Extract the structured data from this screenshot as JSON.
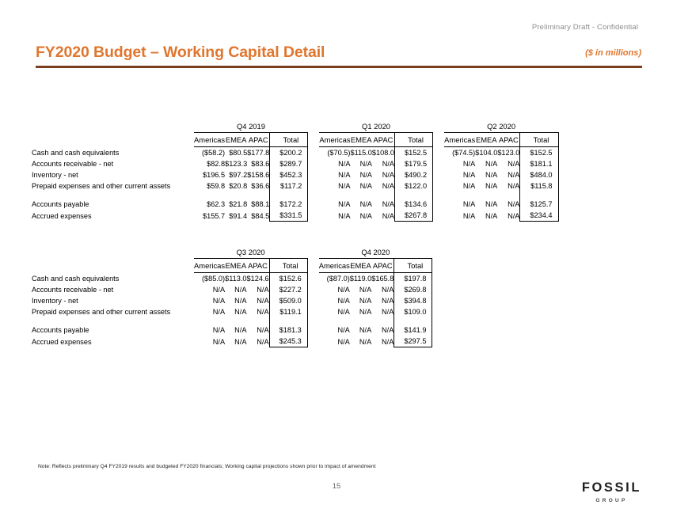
{
  "header": {
    "confidential": "Preliminary Draft - Confidential",
    "title": "FY2020 Budget – Working Capital Detail",
    "units": "($ in millions)",
    "accent_color": "#e0762e",
    "rule_color": "#7b3f1d"
  },
  "row_labels": [
    "Cash and cash equivalents",
    "Accounts receivable - net",
    "Inventory  - net",
    "Prepaid expenses and other current assets",
    "Accounts payable",
    "Accrued expenses"
  ],
  "column_headers": [
    "Americas",
    "EMEA",
    "APAC",
    "Total"
  ],
  "table_one": {
    "quarters": [
      "Q4 2019",
      "Q1 2020",
      "Q2 2020"
    ],
    "groups": [
      {
        "quarter": "Q4 2019",
        "rows": [
          [
            "($58.2)",
            "$80.5",
            "$177.8",
            "$200.2"
          ],
          [
            "$82.8",
            "$123.3",
            "$83.6",
            "$289.7"
          ],
          [
            "$196.5",
            "$97.2",
            "$158.6",
            "$452.3"
          ],
          [
            "$59.8",
            "$20.8",
            "$36.6",
            "$117.2"
          ],
          [
            "$62.3",
            "$21.8",
            "$88.1",
            "$172.2"
          ],
          [
            "$155.7",
            "$91.4",
            "$84.5",
            "$331.5"
          ]
        ]
      },
      {
        "quarter": "Q1 2020",
        "rows": [
          [
            "($70.5)",
            "$115.0",
            "$108.0",
            "$152.5"
          ],
          [
            "N/A",
            "N/A",
            "N/A",
            "$179.5"
          ],
          [
            "N/A",
            "N/A",
            "N/A",
            "$490.2"
          ],
          [
            "N/A",
            "N/A",
            "N/A",
            "$122.0"
          ],
          [
            "N/A",
            "N/A",
            "N/A",
            "$134.6"
          ],
          [
            "N/A",
            "N/A",
            "N/A",
            "$267.8"
          ]
        ]
      },
      {
        "quarter": "Q2 2020",
        "rows": [
          [
            "($74.5)",
            "$104.0",
            "$123.0",
            "$152.5"
          ],
          [
            "N/A",
            "N/A",
            "N/A",
            "$181.1"
          ],
          [
            "N/A",
            "N/A",
            "N/A",
            "$484.0"
          ],
          [
            "N/A",
            "N/A",
            "N/A",
            "$115.8"
          ],
          [
            "N/A",
            "N/A",
            "N/A",
            "$125.7"
          ],
          [
            "N/A",
            "N/A",
            "N/A",
            "$234.4"
          ]
        ]
      }
    ]
  },
  "table_two": {
    "quarters": [
      "Q3 2020",
      "Q4 2020"
    ],
    "groups": [
      {
        "quarter": "Q3 2020",
        "rows": [
          [
            "($85.0)",
            "$113.0",
            "$124.6",
            "$152.6"
          ],
          [
            "N/A",
            "N/A",
            "N/A",
            "$227.2"
          ],
          [
            "N/A",
            "N/A",
            "N/A",
            "$509.0"
          ],
          [
            "N/A",
            "N/A",
            "N/A",
            "$119.1"
          ],
          [
            "N/A",
            "N/A",
            "N/A",
            "$181.3"
          ],
          [
            "N/A",
            "N/A",
            "N/A",
            "$245.3"
          ]
        ]
      },
      {
        "quarter": "Q4 2020",
        "rows": [
          [
            "($87.0)",
            "$119.0",
            "$165.8",
            "$197.8"
          ],
          [
            "N/A",
            "N/A",
            "N/A",
            "$269.8"
          ],
          [
            "N/A",
            "N/A",
            "N/A",
            "$394.8"
          ],
          [
            "N/A",
            "N/A",
            "N/A",
            "$109.0"
          ],
          [
            "N/A",
            "N/A",
            "N/A",
            "$141.9"
          ],
          [
            "N/A",
            "N/A",
            "N/A",
            "$297.5"
          ]
        ]
      }
    ]
  },
  "footer": {
    "note": "Note: Reflects preliminary Q4 FY2019 results and budgeted FY2020 financials; Working capital projections shown prior to impact of amendment",
    "page_number": "15",
    "logo_main": "FOSSIL",
    "logo_sub": "GROUP"
  }
}
